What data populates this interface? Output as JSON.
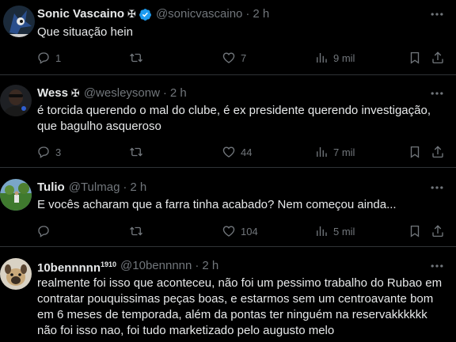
{
  "tweets": [
    {
      "name": "Sonic Vascaino",
      "flag": "✠",
      "verified": true,
      "handle": "@sonicvascaino",
      "time": "2 h",
      "text": "Que situação hein",
      "replies": "1",
      "reposts": "",
      "likes": "7",
      "views": "9 mil"
    },
    {
      "name": "Wess",
      "flag": "✠",
      "verified": false,
      "handle": "@wesleysonw",
      "time": "2 h",
      "text": "é torcida querendo o mal do clube, é ex presidente querendo investigação, que bagulho asqueroso",
      "replies": "3",
      "reposts": "",
      "likes": "44",
      "views": "7 mil"
    },
    {
      "name": "Tulio",
      "flag": "",
      "verified": false,
      "handle": "@Tulmag",
      "time": "2 h",
      "text": "E vocês acharam que a farra tinha acabado? Nem começou ainda...",
      "replies": "",
      "reposts": "",
      "likes": "104",
      "views": "5 mil"
    },
    {
      "name": "10bennnnn",
      "name_sup": "1910",
      "flag": "",
      "verified": false,
      "handle": "@10bennnnn",
      "time": "2 h",
      "text": "realmente foi isso que aconteceu, não foi um pessimo trabalho do Rubao em contratar pouquissimas peças boas, e estarmos sem um centroavante bom em 6 meses de temporada, além da pontas ter ninguém na reservakkkkkk não foi isso nao, foi tudo marketizado pelo augusto melo"
    }
  ],
  "dot": "·",
  "icons": {
    "reply": "reply-icon",
    "repost": "repost-icon",
    "like": "like-icon",
    "views": "views-icon",
    "bookmark": "bookmark-icon",
    "share": "share-icon",
    "more": "more-icon",
    "verified": "verified-badge-icon"
  },
  "colors": {
    "background": "#000000",
    "text": "#e7e9ea",
    "muted": "#71767b",
    "divider": "#2f3336",
    "verified": "#1d9bf0"
  }
}
